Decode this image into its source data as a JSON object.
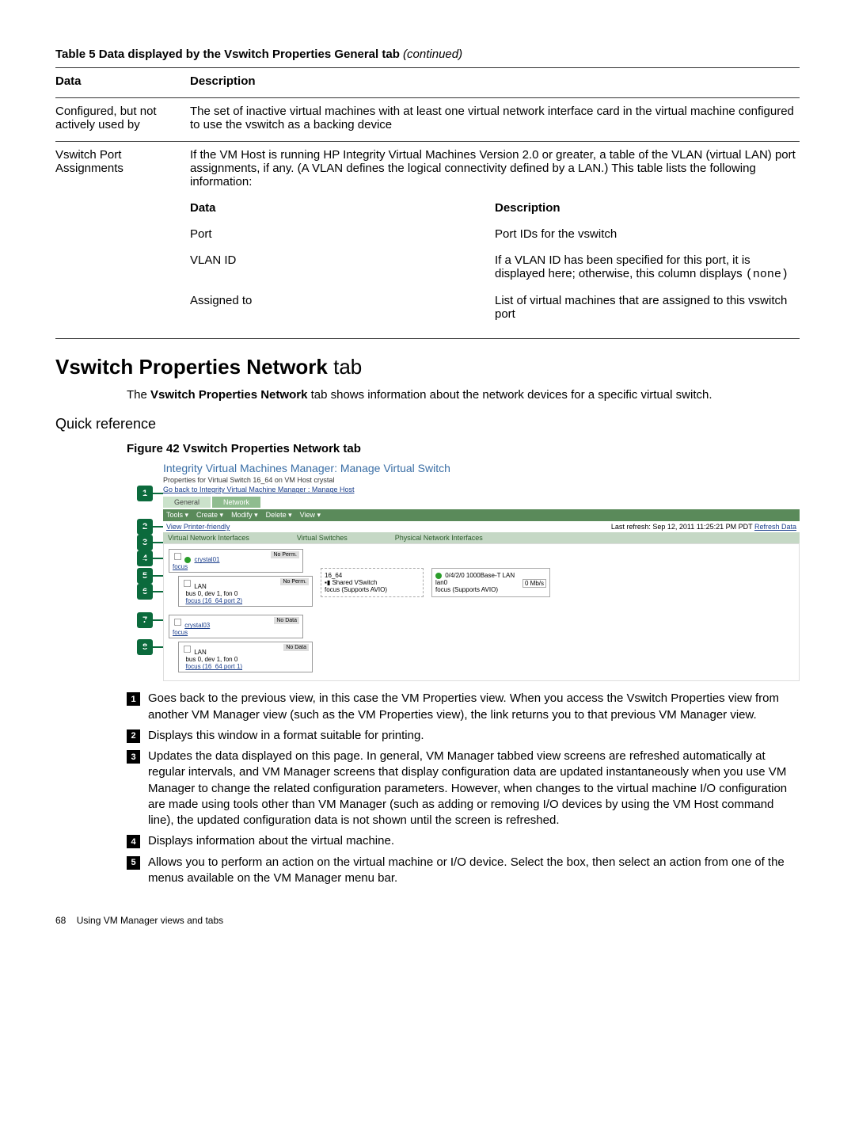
{
  "table_title_bold": "Table 5 Data displayed by the Vswitch Properties General tab",
  "table_title_italic": "(continued)",
  "table": {
    "h_data": "Data",
    "h_desc": "Description",
    "rows": [
      {
        "data": "Configured, but not actively used by",
        "desc": "The set of inactive virtual machines with at least one virtual network interface card in the virtual machine configured to use the vswitch as a backing device"
      },
      {
        "data": "Vswitch Port Assignments",
        "desc": "If the VM Host is running HP Integrity Virtual Machines Version 2.0 or greater, a table of the VLAN (virtual LAN) port assignments, if any. (A VLAN defines the logical connectivity defined by a LAN.) This table lists the following information:"
      }
    ],
    "subheader": {
      "data": "Data",
      "desc": "Description"
    },
    "subrows": [
      {
        "data": "Port",
        "desc": "Port IDs for the vswitch"
      },
      {
        "data": "VLAN ID",
        "desc_pre": "If a VLAN ID has been specified for this port, it is displayed here; otherwise, this column displays ",
        "desc_mono": "(none)"
      },
      {
        "data": "Assigned to",
        "desc": "List of virtual machines that are assigned to this vswitch port"
      }
    ]
  },
  "section_heading_bold": "Vswitch Properties Network",
  "section_heading_normal": " tab",
  "intro_parts": {
    "pre": "The ",
    "bold": "Vswitch Properties Network",
    "post": " tab shows information about the network devices for a specific virtual switch."
  },
  "quick_ref": "Quick reference",
  "figure_title": "Figure 42 Vswitch Properties Network tab",
  "screenshot": {
    "title": "Integrity Virtual Machines Manager: Manage Virtual Switch",
    "subtitle": "Properties for Virtual Switch 16_64 on VM Host crystal",
    "backlink": "Go back to Integrity Virtual Machine Manager : Manage Host",
    "tabs": {
      "general": "General",
      "network": "Network"
    },
    "menu": [
      "Tools ▾",
      "Create ▾",
      "Modify ▾",
      "Delete ▾",
      "View ▾"
    ],
    "printer": "View Printer-friendly",
    "refresh_pre": "Last refresh: Sep 12, 2011 11:25:21 PM PDT ",
    "refresh_link": "Refresh Data",
    "sections": [
      "Virtual Network Interfaces",
      "Virtual Switches",
      "Physical Network Interfaces"
    ],
    "vm1": {
      "name": "crystal01",
      "focus": "focus",
      "note": "No Perm."
    },
    "vm1_lan": {
      "title": "LAN",
      "line": "bus 0, dev 1, fon 0",
      "focus": "focus (16_64 port 2)",
      "note": "No Perm."
    },
    "vm2": {
      "name": "crystal03",
      "focus": "focus",
      "note": "No Data"
    },
    "vm2_lan": {
      "title": "LAN",
      "line": "bus 0, dev 1, fon 0",
      "focus": "focus (16_64 port 1)",
      "note": "No Data"
    },
    "mid": {
      "name": "16_64",
      "shared": "Shared VSwitch",
      "focus": "focus (Supports AVIO)"
    },
    "right": {
      "line1": "0/4/2/0 1000Base-T LAN",
      "line2": "lan0",
      "speed": "0 Mb/s",
      "focus": "focus (Supports AVIO)"
    }
  },
  "callouts": [
    "Goes back to the previous view, in this case the VM Properties view. When you access the Vswitch Properties view from another VM Manager view (such as the VM Properties view), the link returns you to that previous VM Manager view.",
    "Displays this window in a format suitable for printing.",
    "Updates the data displayed on this page. In general, VM Manager tabbed view screens are refreshed automatically at regular intervals, and VM Manager screens that display configuration data are updated instantaneously when you use VM Manager to change the related configuration parameters. However, when changes to the virtual machine I/O configuration are made using tools other than VM Manager (such as adding or removing I/O devices by using the VM Host command line), the updated configuration data is not shown until the screen is refreshed.",
    "Displays information about the virtual machine.",
    "Allows you to perform an action on the virtual machine or I/O device. Select the box, then select an action from one of the menus available on the VM Manager menu bar."
  ],
  "badges": [
    "1",
    "2",
    "3",
    "4",
    "5",
    "6",
    "7",
    "8"
  ],
  "footer": {
    "page": "68",
    "chapter": "Using VM Manager views and tabs"
  }
}
